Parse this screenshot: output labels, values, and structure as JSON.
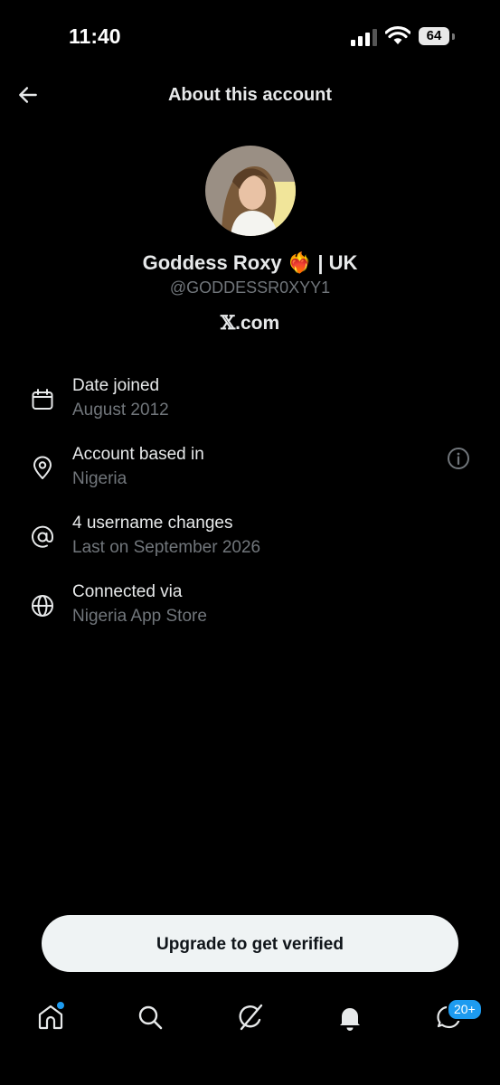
{
  "status_bar": {
    "time": "11:40",
    "battery": "64"
  },
  "header": {
    "title": "About this account"
  },
  "profile": {
    "display_name": "Goddess Roxy",
    "name_emoji": "❤️‍🔥",
    "name_suffix": "| UK",
    "handle": "@GODDESSR0XYY1",
    "site_prefix": "𝕏",
    "site_suffix": ".com"
  },
  "details": [
    {
      "icon": "calendar-icon",
      "label": "Date joined",
      "value": "August 2012"
    },
    {
      "icon": "location-pin-icon",
      "label": "Account based in",
      "value": "Nigeria"
    },
    {
      "icon": "at-sign-icon",
      "label": "4 username changes",
      "value": "Last on September 2026"
    },
    {
      "icon": "globe-icon",
      "label": "Connected via",
      "value": "Nigeria App Store"
    }
  ],
  "upgrade_button": {
    "label": "Upgrade to get verified"
  },
  "nav": {
    "messages_badge": "20+"
  },
  "colors": {
    "background": "#000000",
    "text_primary": "#e7e9ea",
    "text_secondary": "#71767b",
    "accent": "#1d9bf0",
    "button_bg": "#eff3f4"
  }
}
